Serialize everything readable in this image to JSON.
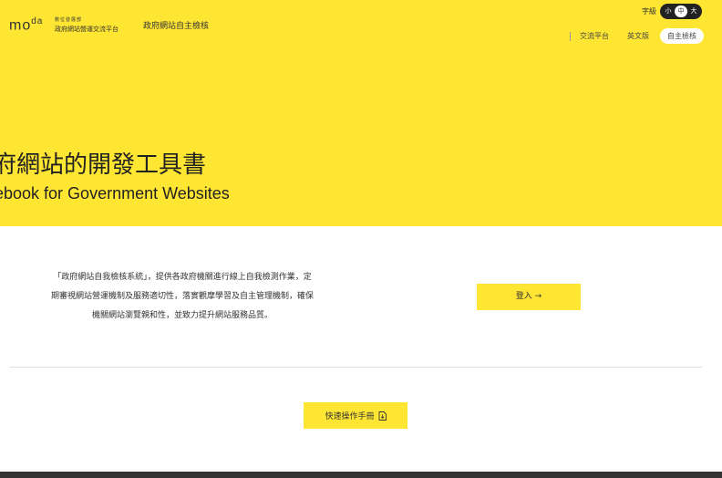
{
  "header": {
    "logo": "mo",
    "logo_sup": "da",
    "org_line1": "數位發展部",
    "org_line2": "政府網站營運交流平台",
    "site_name": "政府網站自主檢核",
    "font_size_label": "字級",
    "font_sizes": [
      "小",
      "中",
      "大"
    ],
    "nav": [
      "交流平台",
      "英文版",
      "自主檢核"
    ]
  },
  "hero": {
    "title": "府網站的開發工具書",
    "subtitle": "ebook for Government Websites"
  },
  "main": {
    "intro_line1": "「政府網站自我檢核系統」，提供各政府機關進行線上自我檢測作業，定",
    "intro_line2": "期審視網站營運機制及服務適切性，落實觀摩學習及自主管理機制，確保",
    "intro_line3": "機關網站瀏覽親和性，並致力提升網站服務品質。",
    "login_label": "登入 →",
    "manual_label": "快速操作手冊"
  },
  "colors": {
    "accent": "#ffe633",
    "dark": "#222222"
  }
}
